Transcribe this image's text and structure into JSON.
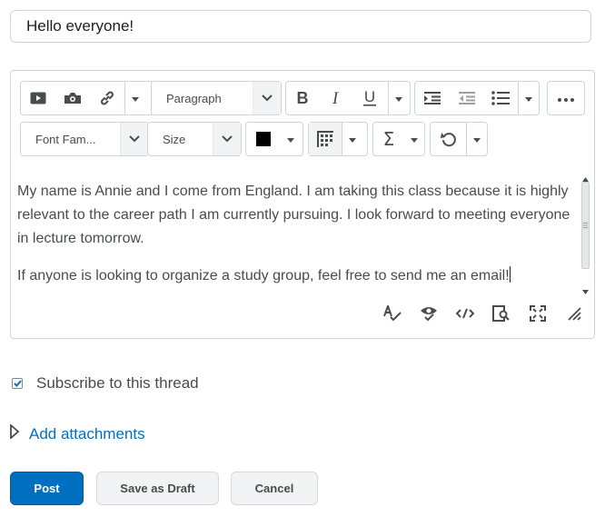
{
  "subject": {
    "value": "Hello everyone!"
  },
  "toolbar": {
    "block_format": "Paragraph",
    "font_family": "Font Fam...",
    "font_size": "Size",
    "text_color": "#000000",
    "sigma_glyph": "Σ"
  },
  "content": {
    "paragraphs": [
      "My name is Annie and I come from England. I am taking this class because it is highly relevant to the career path I am currently pursuing. I look forward to meeting everyone in lecture tomorrow.",
      "If anyone is looking to organize a study group, feel free to send me an email!"
    ]
  },
  "subscribe": {
    "label": "Subscribe to this thread",
    "checked": true
  },
  "attachments": {
    "label": "Add attachments"
  },
  "buttons": {
    "post": "Post",
    "draft": "Save as Draft",
    "cancel": "Cancel"
  },
  "colors": {
    "primary": "#006fbf",
    "link": "#006fbf",
    "text": "#494c4e",
    "border": "#cdd5dc"
  }
}
